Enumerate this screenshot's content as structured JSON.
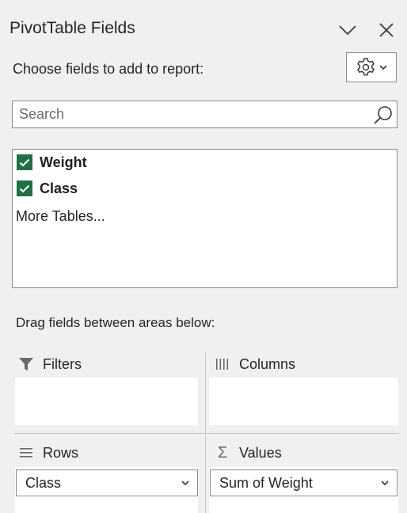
{
  "pane": {
    "title": "PivotTable Fields",
    "choose_label": "Choose fields to add to report:",
    "drag_label": "Drag fields between areas below:"
  },
  "search": {
    "placeholder": "Search"
  },
  "fields": [
    {
      "label": "Weight",
      "checked": true
    },
    {
      "label": "Class",
      "checked": true
    }
  ],
  "more_tables_label": "More Tables...",
  "areas": {
    "filters": {
      "label": "Filters",
      "icon": "filter-icon"
    },
    "columns": {
      "label": "Columns",
      "icon": "columns-icon"
    },
    "rows": {
      "label": "Rows",
      "icon": "rows-icon",
      "items": [
        "Class"
      ]
    },
    "values": {
      "label": "Values",
      "icon": "sigma-icon",
      "items": [
        "Sum of Weight"
      ]
    }
  },
  "colors": {
    "checkbox": "#1e7145",
    "background": "#f0f0f0",
    "border": "#8a8a8a"
  }
}
